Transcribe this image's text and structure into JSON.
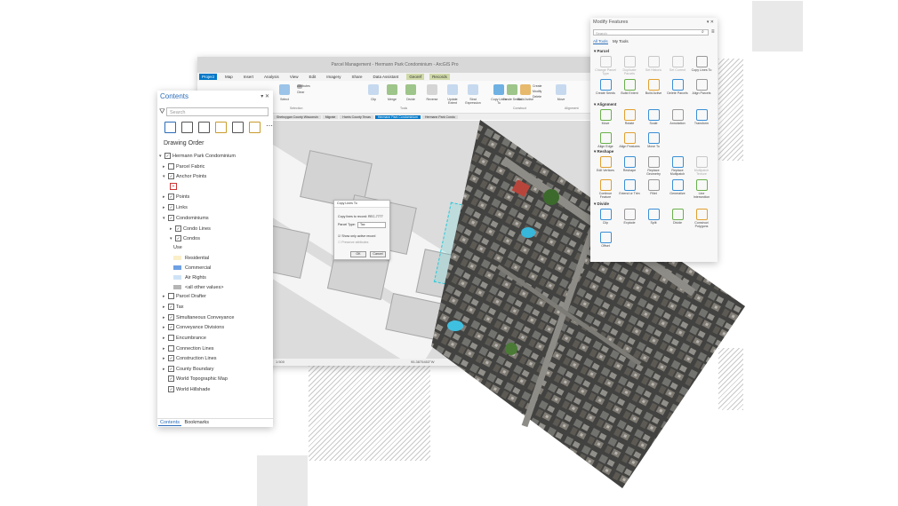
{
  "app": {
    "title": "Parcel Management - Hermann Park Condominium - ArcGIS Pro",
    "ribbon_tabs": [
      "Project",
      "Map",
      "Insert",
      "Analysis",
      "View",
      "Edit",
      "Imagery",
      "Share",
      "Data Assistant"
    ],
    "context_tabs": [
      "Georef",
      "Records"
    ],
    "context_headers": [
      "Map",
      "Parcels"
    ],
    "active_tab": "Project",
    "ribbon_buttons": [
      "Select",
      "Attributes",
      "Clear",
      "Clip",
      "Merge",
      "Divide",
      "Reverse",
      "Update Extent",
      "Strat Expression",
      "Copy Lines To",
      "Create Seeds",
      "Build Active",
      "Create",
      "Modify",
      "Delete",
      "Move"
    ],
    "ribbon_groups": [
      "Selection",
      "Tools",
      "Construct",
      "Alignment"
    ],
    "map_tabs": [
      "Sheboygan County Wisconsin",
      "Migrate",
      "Harris County Texas",
      "Hermann Park Condominium",
      "Hermann Park Condo"
    ],
    "active_map_tab": "Hermann Park Condominium",
    "scale": "1:500",
    "coordinates": "95.3875453°W"
  },
  "dialog": {
    "title": "Copy Lines To",
    "prompt": "Copy lines to record: REC-7777",
    "parcel_type_label": "Parcel Type:",
    "parcel_type_value": "Tax",
    "check1": "Show only active record",
    "check2": "Preserve attributes",
    "ok": "OK",
    "cancel": "Cancel"
  },
  "contents": {
    "title": "Contents",
    "search_placeholder": "Search",
    "drawing_order": "Drawing Order",
    "root": "Hermann Park Condominium",
    "layers": [
      {
        "label": "Parcel Fabric",
        "toggle": "▸",
        "checked": false
      },
      {
        "label": "Anchor Points",
        "toggle": "▾",
        "checked": true
      },
      {
        "label": "Points",
        "toggle": "▸",
        "checked": true
      },
      {
        "label": "Links",
        "toggle": "▸",
        "checked": true
      },
      {
        "label": "Condominiums",
        "toggle": "▾",
        "checked": true
      },
      {
        "label": "Condo Lines",
        "toggle": "▸",
        "checked": true
      },
      {
        "label": "Condos",
        "toggle": "▾",
        "checked": true
      },
      {
        "label": "Parcel Drafter",
        "toggle": "▸",
        "checked": false
      },
      {
        "label": "Tax",
        "toggle": "▸",
        "checked": true
      },
      {
        "label": "Simultaneous Conveyance",
        "toggle": "▸",
        "checked": true
      },
      {
        "label": "Conveyance Divisions",
        "toggle": "▸",
        "checked": true
      },
      {
        "label": "Encumbrance",
        "toggle": "▸",
        "checked": false
      },
      {
        "label": "Connection Lines",
        "toggle": "▸",
        "checked": false
      },
      {
        "label": "Construction Lines",
        "toggle": "▸",
        "checked": true
      },
      {
        "label": "County Boundary",
        "toggle": "▸",
        "checked": true
      },
      {
        "label": "World Topographic Map",
        "toggle": "",
        "checked": true
      },
      {
        "label": "World Hillshade",
        "toggle": "",
        "checked": true
      }
    ],
    "use_label": "Use",
    "legend": [
      {
        "label": "Residential",
        "color": "#fbefc9"
      },
      {
        "label": "Commercial",
        "color": "#6ea0e4"
      },
      {
        "label": "Air Rights",
        "color": "#cfe3f7"
      },
      {
        "label": "<all other values>",
        "color": "#b5b5b5"
      }
    ],
    "footer_tabs": [
      "Contents",
      "Bookmarks"
    ]
  },
  "modify": {
    "title": "Modify Features",
    "search_placeholder": "Search",
    "tabs": [
      "All Tools",
      "My Tools"
    ],
    "sections": [
      {
        "name": "Parcel",
        "tools": [
          {
            "label": "Change Parcel Type",
            "dim": true
          },
          {
            "label": "Duplicate Parcels",
            "dim": true
          },
          {
            "label": "Set Historic",
            "dim": true
          },
          {
            "label": "Set Current",
            "dim": true
          },
          {
            "label": "Copy Lines To",
            "dim": false
          },
          {
            "label": "Create Seeds",
            "dim": false
          },
          {
            "label": "Build Extent",
            "dim": false
          },
          {
            "label": "Build Active",
            "dim": false
          },
          {
            "label": "Delete Parcels",
            "dim": false
          },
          {
            "label": "Align Parcels",
            "dim": false
          }
        ]
      },
      {
        "name": "Alignment",
        "tools": [
          {
            "label": "Move",
            "dim": false
          },
          {
            "label": "Rotate",
            "dim": false
          },
          {
            "label": "Scale",
            "dim": false
          },
          {
            "label": "Annotation",
            "dim": false
          },
          {
            "label": "Transform",
            "dim": false
          },
          {
            "label": "Align Edge",
            "dim": false
          },
          {
            "label": "Align Features",
            "dim": false
          },
          {
            "label": "Move To",
            "dim": false
          }
        ]
      },
      {
        "name": "Reshape",
        "tools": [
          {
            "label": "Edit Vertices",
            "dim": false
          },
          {
            "label": "Reshape",
            "dim": false
          },
          {
            "label": "Replace Geometry",
            "dim": false
          },
          {
            "label": "Replace Multipatch",
            "dim": false
          },
          {
            "label": "Multipatch Texture",
            "dim": true
          },
          {
            "label": "Continue Feature",
            "dim": false
          },
          {
            "label": "Extend or Trim",
            "dim": false
          },
          {
            "label": "Fillet",
            "dim": false
          },
          {
            "label": "Generalize",
            "dim": false
          },
          {
            "label": "Line Intersection",
            "dim": false
          }
        ]
      },
      {
        "name": "Divide",
        "tools": [
          {
            "label": "Clip",
            "dim": false
          },
          {
            "label": "Explode",
            "dim": false
          },
          {
            "label": "Split",
            "dim": false
          },
          {
            "label": "Divide",
            "dim": false
          },
          {
            "label": "Construct Polygons",
            "dim": false
          },
          {
            "label": "Offset",
            "dim": false
          }
        ]
      }
    ]
  }
}
